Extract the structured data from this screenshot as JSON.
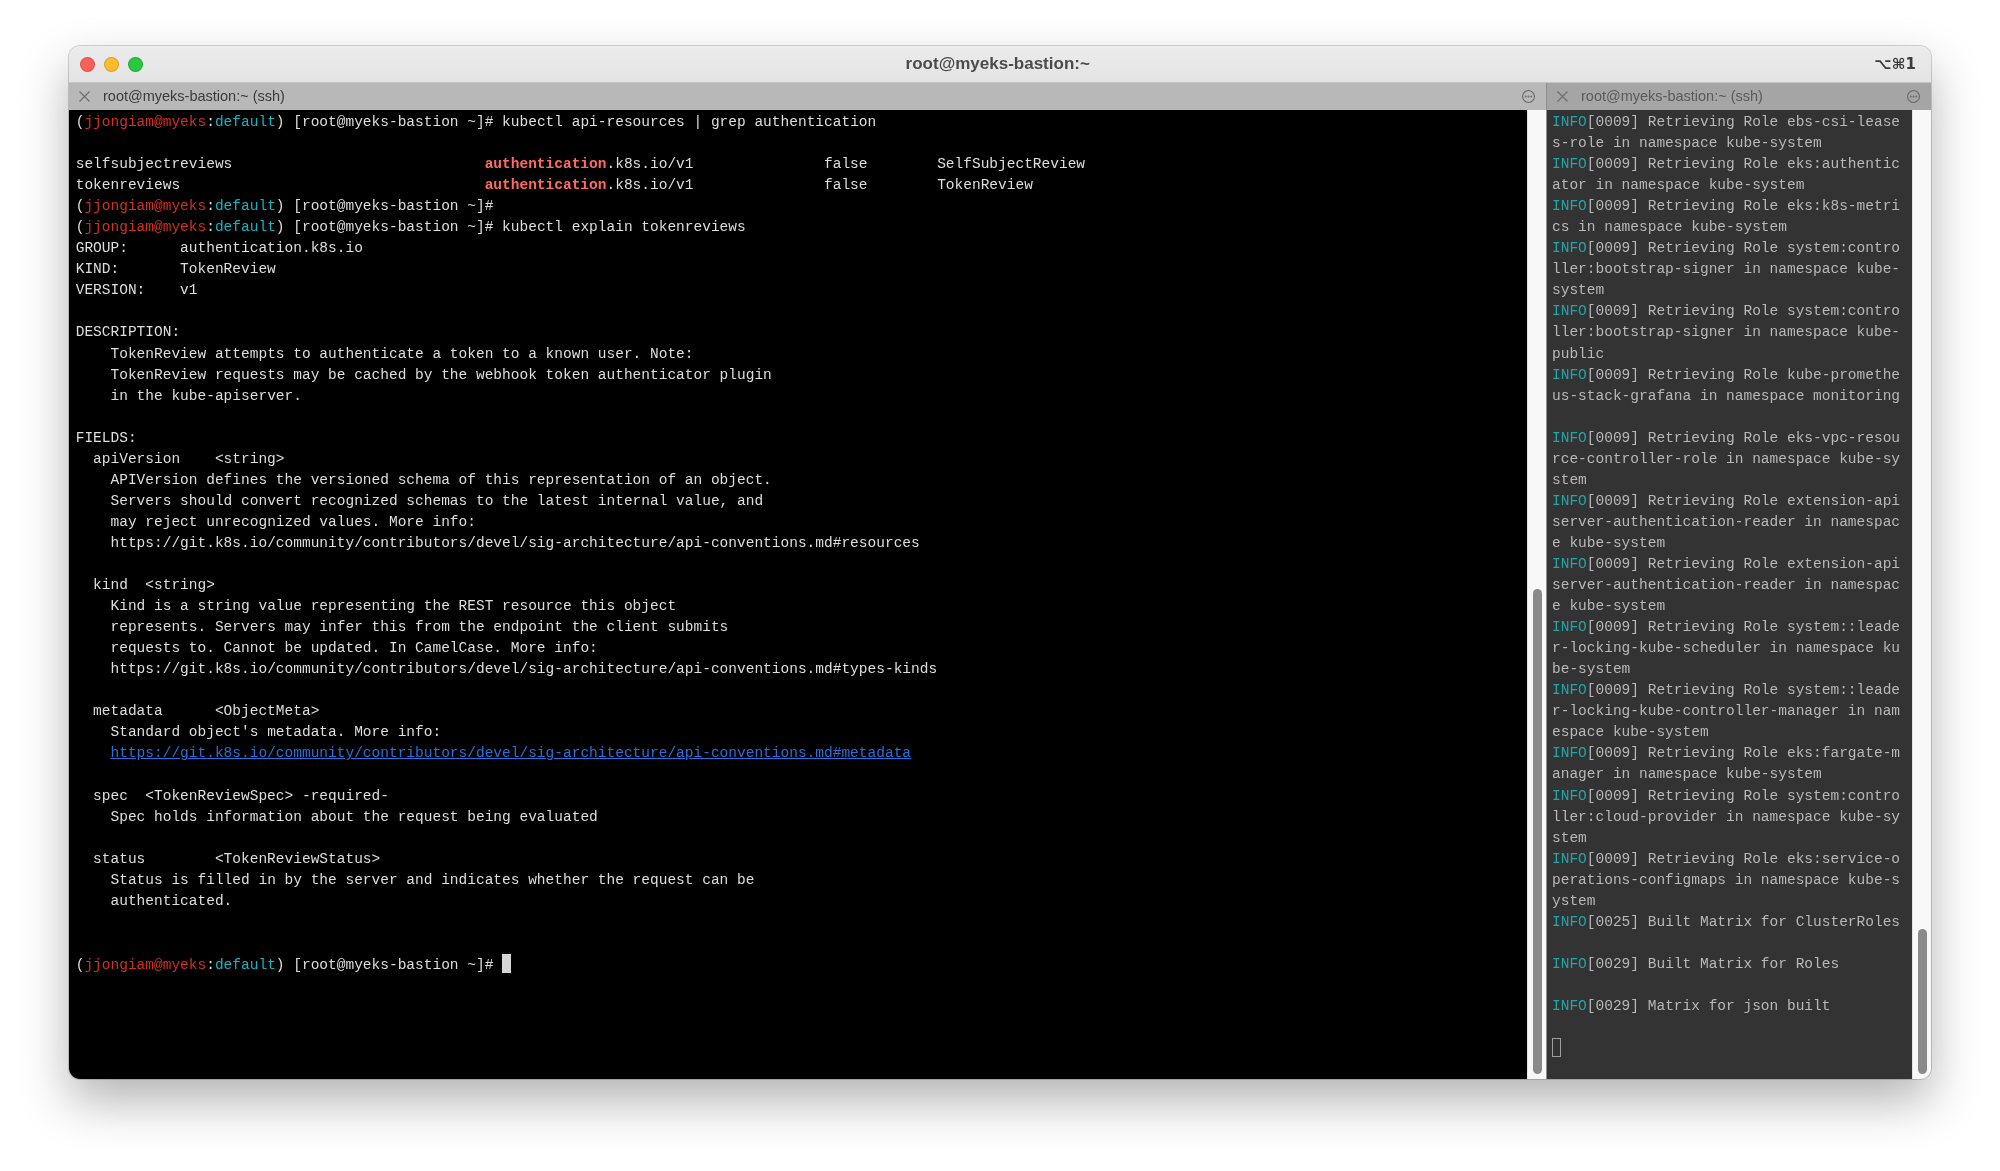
{
  "window": {
    "title": "root@myeks-bastion:~",
    "shortcut": "⌥⌘1"
  },
  "panes": [
    {
      "selected": true,
      "tab": {
        "title": "root@myeks-bastion:~ (ssh)"
      },
      "lines": [
        {
          "kind": "prompt",
          "segments": [
            {
              "kind": "plain",
              "text": "("
            },
            {
              "kind": "user",
              "text": "jjongiam@myeks"
            },
            {
              "kind": "plain",
              "text": ":"
            },
            {
              "kind": "context",
              "text": "default"
            },
            {
              "kind": "plain",
              "text": ") [root@myeks-bastion ~]# kubectl api-resources | grep authentication"
            }
          ]
        },
        {
          "kind": "blank"
        },
        {
          "kind": "output",
          "segments": [
            {
              "kind": "plain",
              "text": "selfsubjectreviews                             "
            },
            {
              "kind": "match",
              "text": "authentication"
            },
            {
              "kind": "plain",
              "text": ".k8s.io/v1               false        SelfSubjectReview"
            }
          ]
        },
        {
          "kind": "output",
          "segments": [
            {
              "kind": "plain",
              "text": "tokenreviews                                   "
            },
            {
              "kind": "match",
              "text": "authentication"
            },
            {
              "kind": "plain",
              "text": ".k8s.io/v1               false        TokenReview"
            }
          ]
        },
        {
          "kind": "prompt",
          "segments": [
            {
              "kind": "plain",
              "text": "("
            },
            {
              "kind": "user",
              "text": "jjongiam@myeks"
            },
            {
              "kind": "plain",
              "text": ":"
            },
            {
              "kind": "context",
              "text": "default"
            },
            {
              "kind": "plain",
              "text": ") [root@myeks-bastion ~]#"
            }
          ]
        },
        {
          "kind": "prompt",
          "segments": [
            {
              "kind": "plain",
              "text": "("
            },
            {
              "kind": "user",
              "text": "jjongiam@myeks"
            },
            {
              "kind": "plain",
              "text": ":"
            },
            {
              "kind": "context",
              "text": "default"
            },
            {
              "kind": "plain",
              "text": ") [root@myeks-bastion ~]# kubectl explain tokenreviews"
            }
          ]
        },
        {
          "kind": "output",
          "text": "GROUP:      authentication.k8s.io"
        },
        {
          "kind": "output",
          "text": "KIND:       TokenReview"
        },
        {
          "kind": "output",
          "text": "VERSION:    v1"
        },
        {
          "kind": "blank"
        },
        {
          "kind": "output",
          "text": "DESCRIPTION:"
        },
        {
          "kind": "output",
          "text": "    TokenReview attempts to authenticate a token to a known user. Note:"
        },
        {
          "kind": "output",
          "text": "    TokenReview requests may be cached by the webhook token authenticator plugin"
        },
        {
          "kind": "output",
          "text": "    in the kube-apiserver."
        },
        {
          "kind": "blank"
        },
        {
          "kind": "output",
          "text": "FIELDS:"
        },
        {
          "kind": "output",
          "text": "  apiVersion    <string>"
        },
        {
          "kind": "output",
          "text": "    APIVersion defines the versioned schema of this representation of an object."
        },
        {
          "kind": "output",
          "text": "    Servers should convert recognized schemas to the latest internal value, and"
        },
        {
          "kind": "output",
          "text": "    may reject unrecognized values. More info:"
        },
        {
          "kind": "output",
          "text": "    https://git.k8s.io/community/contributors/devel/sig-architecture/api-conventions.md#resources"
        },
        {
          "kind": "blank"
        },
        {
          "kind": "output",
          "text": "  kind  <string>"
        },
        {
          "kind": "output",
          "text": "    Kind is a string value representing the REST resource this object"
        },
        {
          "kind": "output",
          "text": "    represents. Servers may infer this from the endpoint the client submits"
        },
        {
          "kind": "output",
          "text": "    requests to. Cannot be updated. In CamelCase. More info:"
        },
        {
          "kind": "output",
          "text": "    https://git.k8s.io/community/contributors/devel/sig-architecture/api-conventions.md#types-kinds"
        },
        {
          "kind": "blank"
        },
        {
          "kind": "output",
          "text": "  metadata      <ObjectMeta>"
        },
        {
          "kind": "output",
          "text": "    Standard object's metadata. More info:"
        },
        {
          "kind": "link",
          "text": "    https://git.k8s.io/community/contributors/devel/sig-architecture/api-conventions.md#metadata"
        },
        {
          "kind": "blank"
        },
        {
          "kind": "output",
          "text": "  spec  <TokenReviewSpec> -required-"
        },
        {
          "kind": "output",
          "text": "    Spec holds information about the request being evaluated"
        },
        {
          "kind": "blank"
        },
        {
          "kind": "output",
          "text": "  status        <TokenReviewStatus>"
        },
        {
          "kind": "output",
          "text": "    Status is filled in by the server and indicates whether the request can be"
        },
        {
          "kind": "output",
          "text": "    authenticated."
        },
        {
          "kind": "blank"
        },
        {
          "kind": "blank"
        },
        {
          "kind": "prompt",
          "segments": [
            {
              "kind": "plain",
              "text": "("
            },
            {
              "kind": "user",
              "text": "jjongiam@myeks"
            },
            {
              "kind": "plain",
              "text": ":"
            },
            {
              "kind": "context",
              "text": "default"
            },
            {
              "kind": "plain",
              "text": ") [root@myeks-bastion ~]#"
            }
          ]
        }
      ]
    },
    {
      "selected": false,
      "tab": {
        "title": "root@myeks-bastion:~ (ssh)"
      },
      "lines": [
        {
          "kind": "log",
          "segments": [
            {
              "kind": "level",
              "text": "INFO"
            },
            {
              "kind": "plain",
              "text": "[0009] Retrieving Role ebs-csi-leases-role in namespace kube-system"
            }
          ]
        },
        {
          "kind": "log",
          "segments": [
            {
              "kind": "level",
              "text": "INFO"
            },
            {
              "kind": "plain",
              "text": "[0009] Retrieving Role eks:authenticator in namespace kube-system"
            }
          ]
        },
        {
          "kind": "log",
          "segments": [
            {
              "kind": "level",
              "text": "INFO"
            },
            {
              "kind": "plain",
              "text": "[0009] Retrieving Role eks:k8s-metrics in namespace kube-system"
            }
          ]
        },
        {
          "kind": "log",
          "segments": [
            {
              "kind": "level",
              "text": "INFO"
            },
            {
              "kind": "plain",
              "text": "[0009] Retrieving Role system:controller:bootstrap-signer in namespace kube-system"
            }
          ]
        },
        {
          "kind": "log",
          "segments": [
            {
              "kind": "level",
              "text": "INFO"
            },
            {
              "kind": "plain",
              "text": "[0009] Retrieving Role system:controller:bootstrap-signer in namespace kube-public"
            }
          ]
        },
        {
          "kind": "log",
          "segments": [
            {
              "kind": "level",
              "text": "INFO"
            },
            {
              "kind": "plain",
              "text": "[0009] Retrieving Role kube-prometheus-stack-grafana in namespace monitoring"
            }
          ]
        },
        {
          "kind": "blank"
        },
        {
          "kind": "log",
          "segments": [
            {
              "kind": "level",
              "text": "INFO"
            },
            {
              "kind": "plain",
              "text": "[0009] Retrieving Role eks-vpc-resource-controller-role in namespace kube-system"
            }
          ]
        },
        {
          "kind": "log",
          "segments": [
            {
              "kind": "level",
              "text": "INFO"
            },
            {
              "kind": "plain",
              "text": "[0009] Retrieving Role extension-apiserver-authentication-reader in namespace kube-system"
            }
          ]
        },
        {
          "kind": "log",
          "segments": [
            {
              "kind": "level",
              "text": "INFO"
            },
            {
              "kind": "plain",
              "text": "[0009] Retrieving Role extension-apiserver-authentication-reader in namespace kube-system"
            }
          ]
        },
        {
          "kind": "log",
          "segments": [
            {
              "kind": "level",
              "text": "INFO"
            },
            {
              "kind": "plain",
              "text": "[0009] Retrieving Role system::leader-locking-kube-scheduler in namespace kube-system"
            }
          ]
        },
        {
          "kind": "log",
          "segments": [
            {
              "kind": "level",
              "text": "INFO"
            },
            {
              "kind": "plain",
              "text": "[0009] Retrieving Role system::leader-locking-kube-controller-manager in namespace kube-system"
            }
          ]
        },
        {
          "kind": "log",
          "segments": [
            {
              "kind": "level",
              "text": "INFO"
            },
            {
              "kind": "plain",
              "text": "[0009] Retrieving Role eks:fargate-manager in namespace kube-system"
            }
          ]
        },
        {
          "kind": "log",
          "segments": [
            {
              "kind": "level",
              "text": "INFO"
            },
            {
              "kind": "plain",
              "text": "[0009] Retrieving Role system:controller:cloud-provider in namespace kube-system"
            }
          ]
        },
        {
          "kind": "log",
          "segments": [
            {
              "kind": "level",
              "text": "INFO"
            },
            {
              "kind": "plain",
              "text": "[0009] Retrieving Role eks:service-operations-configmaps in namespace kube-system"
            }
          ]
        },
        {
          "kind": "log",
          "segments": [
            {
              "kind": "level",
              "text": "INFO"
            },
            {
              "kind": "plain",
              "text": "[0025] Built Matrix for ClusterRoles"
            }
          ]
        },
        {
          "kind": "blank"
        },
        {
          "kind": "log",
          "segments": [
            {
              "kind": "level",
              "text": "INFO"
            },
            {
              "kind": "plain",
              "text": "[0029] Built Matrix for Roles"
            }
          ]
        },
        {
          "kind": "blank"
        },
        {
          "kind": "log",
          "segments": [
            {
              "kind": "level",
              "text": "INFO"
            },
            {
              "kind": "plain",
              "text": "[0029] Matrix for json built"
            }
          ]
        },
        {
          "kind": "blank"
        },
        {
          "kind": "blank"
        }
      ]
    }
  ]
}
